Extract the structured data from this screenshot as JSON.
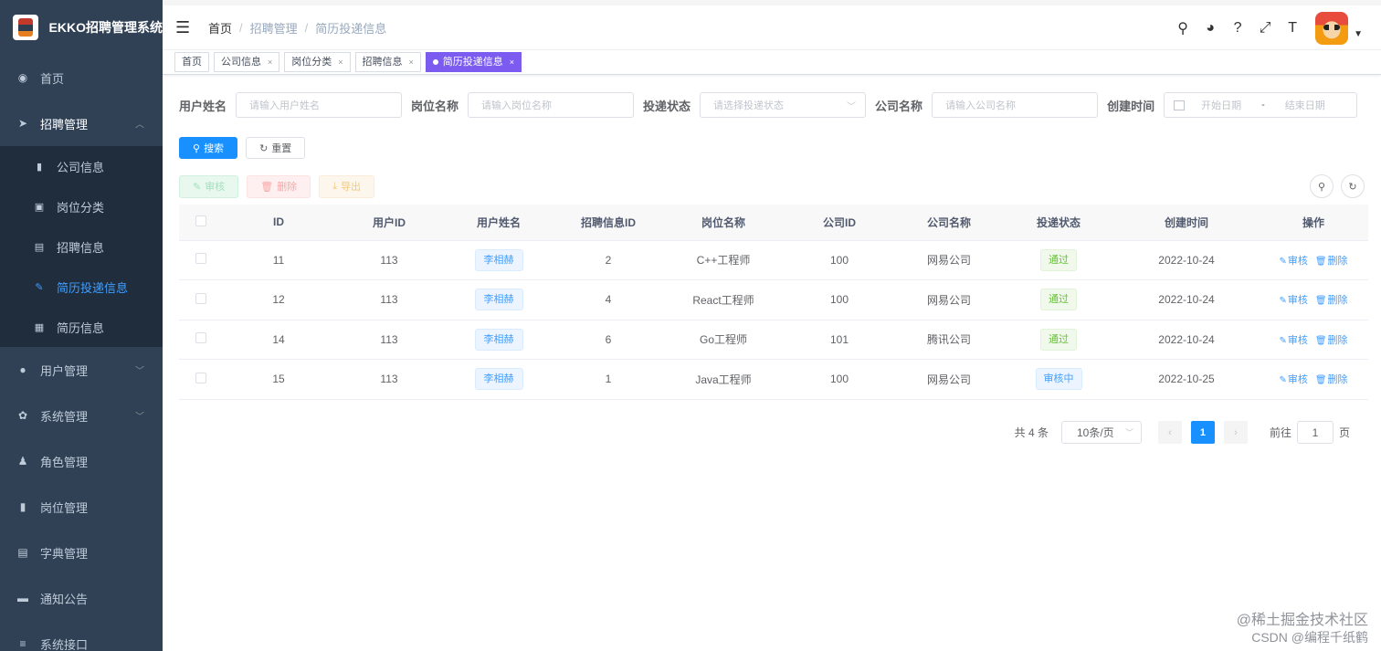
{
  "app": {
    "title": "EKKO招聘管理系统"
  },
  "sidebar": {
    "items": [
      {
        "label": "首页",
        "icon": "dashboard-icon"
      },
      {
        "label": "招聘管理",
        "icon": "send-icon",
        "open": true,
        "children": [
          {
            "label": "公司信息",
            "icon": "building-icon"
          },
          {
            "label": "岗位分类",
            "icon": "category-icon"
          },
          {
            "label": "招聘信息",
            "icon": "message-icon"
          },
          {
            "label": "简历投递信息",
            "icon": "edit-icon",
            "active": true
          },
          {
            "label": "简历信息",
            "icon": "document-icon"
          }
        ]
      },
      {
        "label": "用户管理",
        "icon": "user-icon"
      },
      {
        "label": "系统管理",
        "icon": "gear-icon"
      },
      {
        "label": "角色管理",
        "icon": "peoples-icon"
      },
      {
        "label": "岗位管理",
        "icon": "post-icon"
      },
      {
        "label": "字典管理",
        "icon": "dict-icon"
      },
      {
        "label": "通知公告",
        "icon": "notice-icon"
      },
      {
        "label": "系统接口",
        "icon": "api-icon"
      }
    ]
  },
  "breadcrumb": [
    "首页",
    "招聘管理",
    "简历投递信息"
  ],
  "tags": [
    {
      "label": "首页"
    },
    {
      "label": "公司信息"
    },
    {
      "label": "岗位分类"
    },
    {
      "label": "招聘信息"
    },
    {
      "label": "简历投递信息",
      "active": true
    }
  ],
  "search": {
    "username_label": "用户姓名",
    "username_placeholder": "请输入用户姓名",
    "position_label": "岗位名称",
    "position_placeholder": "请输入岗位名称",
    "status_label": "投递状态",
    "status_placeholder": "请选择投递状态",
    "company_label": "公司名称",
    "company_placeholder": "请输入公司名称",
    "created_label": "创建时间",
    "start_placeholder": "开始日期",
    "end_placeholder": "结束日期",
    "range_sep": "-",
    "search_btn": "搜索",
    "reset_btn": "重置"
  },
  "actions": {
    "audit": "审核",
    "delete": "删除",
    "export": "导出"
  },
  "table": {
    "headers": [
      "ID",
      "用户ID",
      "用户姓名",
      "招聘信息ID",
      "岗位名称",
      "公司ID",
      "公司名称",
      "投递状态",
      "创建时间",
      "操作"
    ],
    "rows": [
      {
        "id": "11",
        "user_id": "113",
        "username": "李相赫",
        "job_id": "2",
        "position": "C++工程师",
        "company_id": "100",
        "company": "网易公司",
        "status": "通过",
        "status_type": "pass",
        "created": "2022-10-24"
      },
      {
        "id": "12",
        "user_id": "113",
        "username": "李相赫",
        "job_id": "4",
        "position": "React工程师",
        "company_id": "100",
        "company": "网易公司",
        "status": "通过",
        "status_type": "pass",
        "created": "2022-10-24"
      },
      {
        "id": "14",
        "user_id": "113",
        "username": "李相赫",
        "job_id": "6",
        "position": "Go工程师",
        "company_id": "101",
        "company": "腾讯公司",
        "status": "通过",
        "status_type": "pass",
        "created": "2022-10-24"
      },
      {
        "id": "15",
        "user_id": "113",
        "username": "李相赫",
        "job_id": "1",
        "position": "Java工程师",
        "company_id": "100",
        "company": "网易公司",
        "status": "审核中",
        "status_type": "review",
        "created": "2022-10-25"
      }
    ],
    "op_audit": "审核",
    "op_delete": "删除"
  },
  "pagination": {
    "total": "共 4 条",
    "page_size": "10条/页",
    "current": "1",
    "goto_label": "前往",
    "goto_value": "1",
    "page_suffix": "页"
  },
  "watermark": {
    "line1": "@稀土掘金技术社区",
    "line2": "CSDN @编程千纸鹤"
  },
  "colors": {
    "sidebar_bg": "#304156",
    "submenu_bg": "#1f2d3d",
    "primary": "#1890ff",
    "active_tag": "#7c5cf0"
  }
}
